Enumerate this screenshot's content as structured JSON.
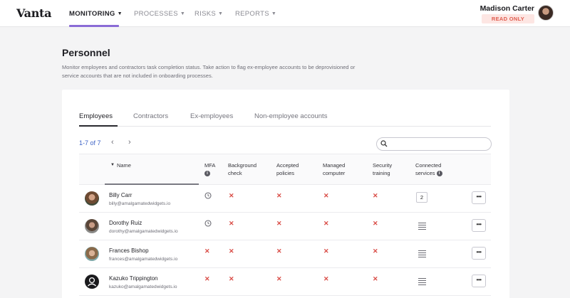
{
  "app": {
    "logo": "Vanta"
  },
  "nav": {
    "items": [
      {
        "label": "MONITORING"
      },
      {
        "label": "PROCESSES"
      },
      {
        "label": "RISKS"
      },
      {
        "label": "REPORTS"
      }
    ],
    "active_index": 0
  },
  "user": {
    "name": "Madison Carter",
    "badge": "READ ONLY"
  },
  "page": {
    "title": "Personnel",
    "description": "Monitor employees and contractors task completion status. Take action to flag ex-employee accounts to be deprovisioned or service accounts that are not included in onboarding processes."
  },
  "tabs": [
    {
      "label": "Employees"
    },
    {
      "label": "Contractors"
    },
    {
      "label": "Ex-employees"
    },
    {
      "label": "Non-employee accounts"
    }
  ],
  "pagination": {
    "count": "1-7 of 7",
    "prev": "‹",
    "next": "›"
  },
  "search": {
    "placeholder": ""
  },
  "table": {
    "headers": {
      "name": "Name",
      "mfa": "MFA",
      "background": "Background check",
      "policies": "Accepted policies",
      "computer": "Managed computer",
      "training": "Security training",
      "services": "Connected services"
    },
    "rows": [
      {
        "name": "Billy Carr",
        "email": "billy@amalgamatedwidgets.io",
        "mfa": "clock",
        "background": "✕",
        "policies": "✕",
        "computer": "✕",
        "training": "✕",
        "services": "2"
      },
      {
        "name": "Dorothy Ruiz",
        "email": "dorothy@amalgamatedwidgets.io",
        "mfa": "clock",
        "background": "✕",
        "policies": "✕",
        "computer": "✕",
        "training": "✕",
        "services": "list"
      },
      {
        "name": "Frances Bishop",
        "email": "frances@amalgamatedwidgets.io",
        "mfa": "✕",
        "background": "✕",
        "policies": "✕",
        "computer": "✕",
        "training": "✕",
        "services": "list"
      },
      {
        "name": "Kazuko Trippington",
        "email": "kazuko@amalgamatedwidgets.io",
        "mfa": "✕",
        "background": "✕",
        "policies": "✕",
        "computer": "✕",
        "training": "✕",
        "services": "list"
      }
    ],
    "more_label": "•••"
  },
  "colors": {
    "accent": "#8a6bd6",
    "link": "#3d63c6",
    "fail": "#d94b45",
    "read_only_bg": "#fde6e3",
    "read_only_text": "#e05d4f"
  },
  "icons": {
    "mfa_pending": "clock-icon",
    "fail": "x-icon",
    "services_list": "list-icon",
    "more": "more-horizontal-icon",
    "search": "search-icon",
    "info": "info-icon"
  }
}
